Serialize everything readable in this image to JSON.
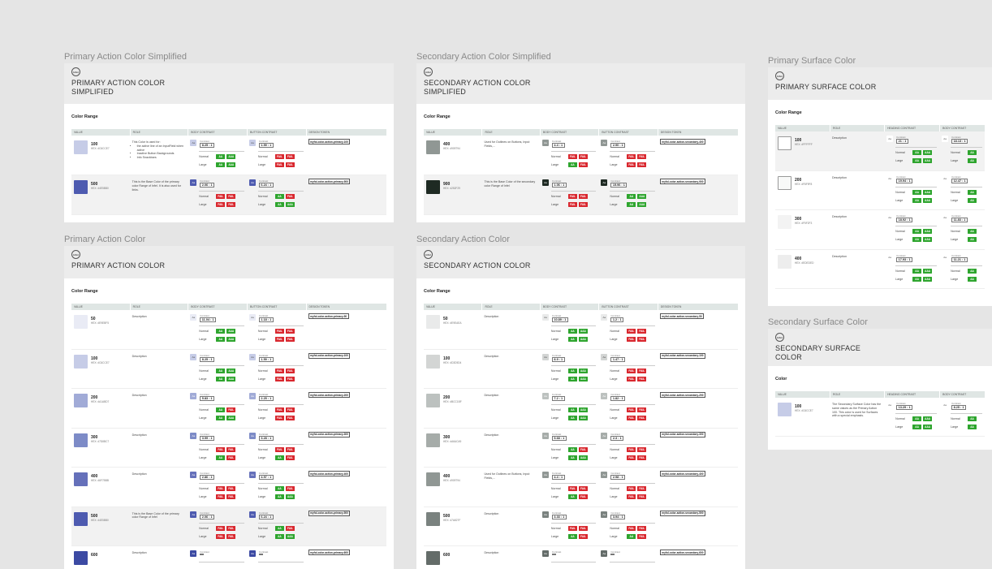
{
  "frames": [
    {
      "id": "pas",
      "frame_title": "Primary Action Color Simplified",
      "card_title": [
        "PRIMARY ACTION COLOR",
        "SIMPLIFIED"
      ],
      "section": "Color Range",
      "columns": [
        "VALUE",
        "ROLE",
        "BODY CONTRAST",
        "BUTTON CONTRAST",
        "DESIGN TOKEN"
      ],
      "rows": [
        {
          "value": "100",
          "hex": "HEX: #C6CCE7",
          "color": "#c6cce7",
          "role_text": "This Color is used for:",
          "role_list": [
            "the active line of an InputField when active",
            "Inactive Button Backgrounds",
            "Info Snackbars"
          ],
          "body_contrast": "8.25 : 1",
          "button_contrast": "1.59 : 1",
          "body_normal": [
            "AA",
            "AAA"
          ],
          "body_large": [
            "AA",
            "AAA"
          ],
          "button_normal": [
            "FAIL",
            "FAIL"
          ],
          "button_large": [
            "FAIL",
            "FAIL"
          ],
          "token": "myfol-color-action-primary-100",
          "highlight": false,
          "chip_color": "#c6cce7",
          "btn_chip_color": "#c6cce7"
        },
        {
          "value": "500",
          "hex": "HEX: #4E5BB0",
          "color": "#4e5bb0",
          "role_text": "This is the Base Color of the primary color Range of Infel. It is also used for links.",
          "role_list": [],
          "body_contrast": "2.06 : 1",
          "button_contrast": "6.24 : 1",
          "body_normal": [
            "FAIL",
            "FAIL"
          ],
          "body_large": [
            "FAIL",
            "FAIL"
          ],
          "button_normal": [
            "AA",
            "FAIL"
          ],
          "button_large": [
            "AA",
            "AAA"
          ],
          "token": "myfol-color-action-primary-500",
          "highlight": true,
          "chip_color": "#4e5bb0",
          "btn_chip_color": "#4e5bb0"
        }
      ]
    },
    {
      "id": "sas",
      "frame_title": "Secondary Action Color Simplified",
      "card_title": [
        "SECONDARY ACTION COLOR",
        "SIMPLIFIED"
      ],
      "section": "Color Range",
      "columns": [
        "VALUE",
        "ROLE",
        "BODY CONTRAST",
        "BUTTON CONTRAST",
        "DESIGN TOKEN"
      ],
      "rows": [
        {
          "value": "400",
          "hex": "HEX: #909794",
          "color": "#909794",
          "role_text": "Used for Outlines on Buttons, Input Fields,...",
          "role_list": [],
          "body_contrast": "4.4 : 1",
          "button_contrast": "2.90 : 1",
          "body_normal": [
            "FAIL",
            "FAIL"
          ],
          "body_large": [
            "AA",
            "FAIL"
          ],
          "button_normal": [
            "FAIL",
            "FAIL"
          ],
          "button_large": [
            "FAIL",
            "FAIL"
          ],
          "token": "myfol-color-action-secondary-400",
          "highlight": false,
          "chip_color": "#909794",
          "btn_chip_color": "#909794"
        },
        {
          "value": "900",
          "hex": "HEX: #252F29",
          "color": "#1e2a23",
          "role_text": "This is the Base Color of the secondary color Range of Infel",
          "role_list": [],
          "body_contrast": "1.06 : 1",
          "button_contrast": "15.96 : 1",
          "body_normal": [
            "FAIL",
            "FAIL"
          ],
          "body_large": [
            "FAIL",
            "FAIL"
          ],
          "button_normal": [
            "AA",
            "AAA"
          ],
          "button_large": [
            "AA",
            "AAA"
          ],
          "token": "myfol-color-action-secondary-900",
          "highlight": true,
          "chip_color": "#1e2a23",
          "btn_chip_color": "#1e2a23"
        }
      ]
    },
    {
      "id": "pa",
      "frame_title": "Primary Action Color",
      "card_title": [
        "PRIMARY ACTION COLOR"
      ],
      "section": "Color Range",
      "columns": [
        "VALUE",
        "ROLE",
        "BODY CONTRAST",
        "BUTTON CONTRAST",
        "DESIGN TOKEN"
      ],
      "rows": [
        {
          "value": "50",
          "hex": "HEX: #E9EBF5",
          "color": "#e9ebf5",
          "role_text": "Description",
          "role_list": [],
          "body_contrast": "11.04 : 1",
          "button_contrast": "1.18 : 1",
          "body_normal": [
            "AA",
            "AAA"
          ],
          "body_large": [
            "AA",
            "AAA"
          ],
          "button_normal": [
            "FAIL",
            "FAIL"
          ],
          "button_large": [
            "FAIL",
            "FAIL"
          ],
          "token": "myfol-color-action-primary-50",
          "highlight": false,
          "chip_color": "#e9ebf5",
          "btn_chip_color": "#e9ebf5"
        },
        {
          "value": "100",
          "hex": "HEX: #C6CCE7",
          "color": "#c6cce7",
          "role_text": "Description",
          "role_list": [],
          "body_contrast": "8.25 : 1",
          "button_contrast": "1.59 : 1",
          "body_normal": [
            "AA",
            "AAA"
          ],
          "body_large": [
            "AA",
            "AAA"
          ],
          "button_normal": [
            "FAIL",
            "FAIL"
          ],
          "button_large": [
            "FAIL",
            "FAIL"
          ],
          "token": "myfol-color-action-primary-100",
          "highlight": false,
          "chip_color": "#c6cce7",
          "btn_chip_color": "#c6cce7"
        },
        {
          "value": "200",
          "hex": "HEX: #A1ABD7",
          "color": "#a1abd7",
          "role_text": "Description",
          "role_list": [],
          "body_contrast": "5.83 : 1",
          "button_contrast": "2.25 : 1",
          "body_normal": [
            "AA",
            "FAIL"
          ],
          "body_large": [
            "AA",
            "AAA"
          ],
          "button_normal": [
            "FAIL",
            "FAIL"
          ],
          "button_large": [
            "FAIL",
            "FAIL"
          ],
          "token": "myfol-color-action-primary-200",
          "highlight": false,
          "chip_color": "#a1abd7",
          "btn_chip_color": "#a1abd7"
        },
        {
          "value": "300",
          "hex": "HEX: #7D8BC7",
          "color": "#7d8bc7",
          "role_text": "Description",
          "role_list": [],
          "body_contrast": "3.99 : 1",
          "button_contrast": "3.28 : 1",
          "body_normal": [
            "FAIL",
            "FAIL"
          ],
          "body_large": [
            "AA",
            "FAIL"
          ],
          "button_normal": [
            "FAIL",
            "FAIL"
          ],
          "button_large": [
            "AA",
            "FAIL"
          ],
          "token": "myfol-color-action-primary-300",
          "highlight": false,
          "chip_color": "#7d8bc7",
          "btn_chip_color": "#7d8bc7"
        },
        {
          "value": "400",
          "hex": "HEX: #6F7BBB",
          "color": "#6570ba",
          "role_text": "Description",
          "role_list": [],
          "body_contrast": "2.86 : 1",
          "button_contrast": "4.57 : 1",
          "body_normal": [
            "FAIL",
            "FAIL"
          ],
          "body_large": [
            "FAIL",
            "FAIL"
          ],
          "button_normal": [
            "AA",
            "FAIL"
          ],
          "button_large": [
            "AA",
            "AAA"
          ],
          "token": "myfol-color-action-primary-400",
          "highlight": false,
          "chip_color": "#6570ba",
          "btn_chip_color": "#6570ba"
        },
        {
          "value": "500",
          "hex": "HEX: #4E5BB0",
          "color": "#4e5bb0",
          "role_text": "This is the Base Color of the primary color Range of Infel",
          "role_list": [],
          "body_contrast": "2.06 : 1",
          "button_contrast": "6.24 : 1",
          "body_normal": [
            "FAIL",
            "FAIL"
          ],
          "body_large": [
            "FAIL",
            "FAIL"
          ],
          "button_normal": [
            "AA",
            "FAIL"
          ],
          "button_large": [
            "AA",
            "AAA"
          ],
          "token": "myfol-color-action-primary-500",
          "highlight": true,
          "chip_color": "#4e5bb0",
          "btn_chip_color": "#4e5bb0"
        },
        {
          "value": "600",
          "hex": "",
          "color": "#3c4aa3",
          "role_text": "Description",
          "role_list": [],
          "body_contrast": "",
          "button_contrast": "",
          "body_normal": [],
          "body_large": [],
          "button_normal": [],
          "button_large": [],
          "token": "myfol-color-action-primary-600",
          "highlight": false,
          "chip_color": "#3c4aa3",
          "btn_chip_color": "#3c4aa3"
        }
      ]
    },
    {
      "id": "sa",
      "frame_title": "Secondary Action Color",
      "card_title": [
        "SECONDARY ACTION COLOR"
      ],
      "section": "Color Range",
      "columns": [
        "VALUE",
        "ROLE",
        "BODY CONTRAST",
        "BUTTON CONTRAST",
        "DESIGN TOKEN"
      ],
      "rows": [
        {
          "value": "50",
          "hex": "HEX: #E9EAEA",
          "color": "#e9eaea",
          "role_text": "Description",
          "role_list": [],
          "body_contrast": "10.89 : 1",
          "button_contrast": "1.2 : 1",
          "body_normal": [
            "AA",
            "AAA"
          ],
          "body_large": [
            "AA",
            "AAA"
          ],
          "button_normal": [
            "FAIL",
            "FAIL"
          ],
          "button_large": [
            "FAIL",
            "FAIL"
          ],
          "token": "myfol-color-action-secondary-50",
          "highlight": false,
          "chip_color": "#e9eaea",
          "btn_chip_color": "#e9eaea"
        },
        {
          "value": "100",
          "hex": "HEX: #D3D5D4",
          "color": "#d3d5d4",
          "role_text": "Description",
          "role_list": [],
          "body_contrast": "8.9 : 1",
          "button_contrast": "1.47 : 1",
          "body_normal": [
            "AA",
            "AAA"
          ],
          "body_large": [
            "AA",
            "AAA"
          ],
          "button_normal": [
            "FAIL",
            "FAIL"
          ],
          "button_large": [
            "FAIL",
            "FAIL"
          ],
          "token": "myfol-color-action-secondary-100",
          "highlight": false,
          "chip_color": "#d3d5d4",
          "btn_chip_color": "#d3d5d4"
        },
        {
          "value": "200",
          "hex": "HEX: #BCC1BF",
          "color": "#bcc1bf",
          "role_text": "Description",
          "role_list": [],
          "body_contrast": "7.2 : 1",
          "button_contrast": "1.82 : 1",
          "body_normal": [
            "AA",
            "AAA"
          ],
          "body_large": [
            "AA",
            "AAA"
          ],
          "button_normal": [
            "FAIL",
            "FAIL"
          ],
          "button_large": [
            "FAIL",
            "FAIL"
          ],
          "token": "myfol-color-action-secondary-200",
          "highlight": false,
          "chip_color": "#bcc1bf",
          "btn_chip_color": "#bcc1bf"
        },
        {
          "value": "300",
          "hex": "HEX: #A6ACA9",
          "color": "#a6aca9",
          "role_text": "Description",
          "role_list": [],
          "body_contrast": "5.68 : 1",
          "button_contrast": "2.3 : 1",
          "body_normal": [
            "AA",
            "FAIL"
          ],
          "body_large": [
            "AA",
            "AAA"
          ],
          "button_normal": [
            "FAIL",
            "FAIL"
          ],
          "button_large": [
            "FAIL",
            "FAIL"
          ],
          "token": "myfol-color-action-secondary-300",
          "highlight": false,
          "chip_color": "#a6aca9",
          "btn_chip_color": "#a6aca9"
        },
        {
          "value": "400",
          "hex": "HEX: #909794",
          "color": "#909794",
          "role_text": "Used for Outlines on Buttons, Input Fields,...",
          "role_list": [],
          "body_contrast": "4.4 : 1",
          "button_contrast": "2.98 : 1",
          "body_normal": [
            "FAIL",
            "FAIL"
          ],
          "body_large": [
            "AA",
            "FAIL"
          ],
          "button_normal": [
            "FAIL",
            "FAIL"
          ],
          "button_large": [
            "FAIL",
            "FAIL"
          ],
          "token": "myfol-color-action-secondary-400",
          "highlight": false,
          "chip_color": "#909794",
          "btn_chip_color": "#909794"
        },
        {
          "value": "500",
          "hex": "HEX: #7A827F",
          "color": "#7a827f",
          "role_text": "Description",
          "role_list": [],
          "body_contrast": "3.33 : 1",
          "button_contrast": "3.94 : 1",
          "body_normal": [
            "FAIL",
            "FAIL"
          ],
          "body_large": [
            "AA",
            "FAIL"
          ],
          "button_normal": [
            "FAIL",
            "FAIL"
          ],
          "button_large": [
            "AA",
            "FAIL"
          ],
          "token": "myfol-color-action-secondary-500",
          "highlight": false,
          "chip_color": "#7a827f",
          "btn_chip_color": "#7a827f"
        },
        {
          "value": "600",
          "hex": "",
          "color": "#646c69",
          "role_text": "Description",
          "role_list": [],
          "body_contrast": "",
          "button_contrast": "",
          "body_normal": [],
          "body_large": [],
          "button_normal": [],
          "button_large": [],
          "token": "myfol-color-action-secondary-600",
          "highlight": false,
          "chip_color": "#646c69",
          "btn_chip_color": "#646c69"
        }
      ]
    }
  ],
  "surface_frames": [
    {
      "id": "ps",
      "frame_title": "Primary Surface Color",
      "card_title": [
        "PRIMARY SURFACE COLOR"
      ],
      "section": "Color Range",
      "columns": [
        "VALUE",
        "ROLE",
        "HEADING CONTRAST",
        "BODY CONTRAST"
      ],
      "rows": [
        {
          "value": "100",
          "hex": "HEX: #FFFFFF",
          "color": "#ffffff",
          "role_text": "Description",
          "role_list": [],
          "heading_contrast": "21 : 1",
          "body_contrast": "18.13 : 1",
          "heading_normal": [
            "AA",
            "AAA"
          ],
          "heading_large": [
            "AA",
            "AAA"
          ],
          "body_normal": [
            "AA"
          ],
          "body_large": [
            "AA"
          ],
          "highlight": true,
          "bordered": true
        },
        {
          "value": "200",
          "hex": "HEX: #F8F9F8",
          "color": "#f8f9f8",
          "role_text": "Description",
          "role_list": [],
          "heading_contrast": "19.94 : 1",
          "body_contrast": "12.47 : 1",
          "heading_normal": [
            "AA",
            "AAA"
          ],
          "heading_large": [
            "AA",
            "AAA"
          ],
          "body_normal": [
            "AA"
          ],
          "body_large": [
            "AA"
          ],
          "highlight": false,
          "bordered": true
        },
        {
          "value": "300",
          "hex": "HEX: #F5F2F3",
          "color": "#f3f3f3",
          "role_text": "Description",
          "role_list": [],
          "heading_contrast": "18.92 : 1",
          "body_contrast": "11.83 : 1",
          "heading_normal": [
            "AA",
            "AAA"
          ],
          "heading_large": [
            "AA",
            "AAA"
          ],
          "body_normal": [
            "AA"
          ],
          "body_large": [
            "AA"
          ],
          "highlight": false,
          "bordered": false
        },
        {
          "value": "400",
          "hex": "HEX: #EDEDED",
          "color": "#ededed",
          "role_text": "Description",
          "role_list": [],
          "heading_contrast": "17.93 : 1",
          "body_contrast": "11.21 : 1",
          "heading_normal": [
            "AA",
            "AAA"
          ],
          "heading_large": [
            "AA",
            "AAA"
          ],
          "body_normal": [
            "AA"
          ],
          "body_large": [
            "AA"
          ],
          "highlight": false,
          "bordered": false
        }
      ]
    },
    {
      "id": "ss",
      "frame_title": "Secondary Surface Color",
      "card_title": [
        "SECONDARY SURFACE",
        "COLOR"
      ],
      "section": "Color",
      "columns": [
        "VALUE",
        "ROLE",
        "HEADING CONTRAST",
        "BODY CONTRAST"
      ],
      "rows": [
        {
          "value": "100",
          "hex": "HEX: #C6CCE7",
          "color": "#c6cce7",
          "role_text": "The Secondary Surface Color has the same values as the Primary Action 100. This color is used for Surfaces with a special emphasis.",
          "role_list": [],
          "heading_contrast": "13.29 : 1",
          "body_contrast": "8.25 : 1",
          "heading_normal": [
            "AA",
            "AAA"
          ],
          "heading_large": [
            "AA",
            "AAA"
          ],
          "body_normal": [
            "AA"
          ],
          "body_large": [
            "AA"
          ],
          "highlight": false,
          "bordered": false
        }
      ]
    }
  ],
  "labels": {
    "contrast": "Contrast",
    "normal": "Normal",
    "large": "Large",
    "logo": "Infel"
  }
}
